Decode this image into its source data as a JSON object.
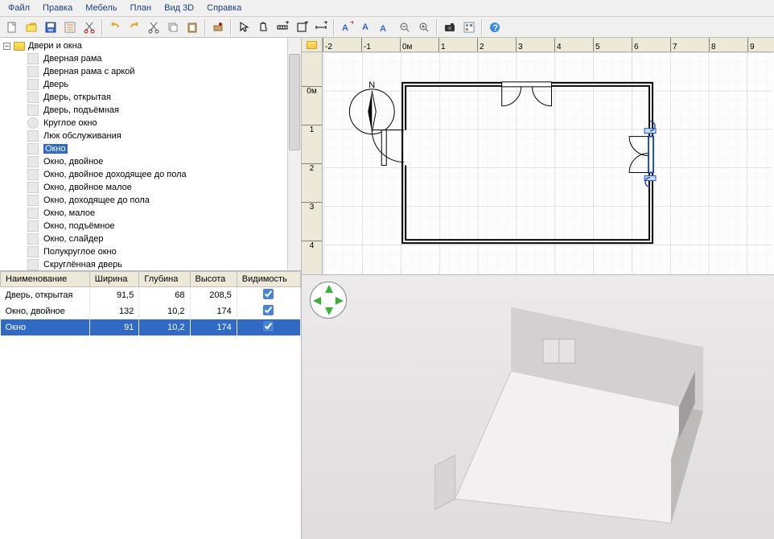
{
  "menu": {
    "items": [
      "Файл",
      "Правка",
      "Мебель",
      "План",
      "Вид 3D",
      "Справка"
    ]
  },
  "catalog": {
    "title": "Двери и окна",
    "items": [
      {
        "label": "Дверная рама"
      },
      {
        "label": "Дверная рама с аркой"
      },
      {
        "label": "Дверь"
      },
      {
        "label": "Дверь, открытая"
      },
      {
        "label": "Дверь, подъёмная"
      },
      {
        "label": "Круглое окно",
        "round": true
      },
      {
        "label": "Люк обслуживания"
      },
      {
        "label": "Окно",
        "selected": true
      },
      {
        "label": "Окно, двойное"
      },
      {
        "label": "Окно, двойное доходящее до пола"
      },
      {
        "label": "Окно, двойное малое"
      },
      {
        "label": "Окно, доходящее до пола"
      },
      {
        "label": "Окно, малое"
      },
      {
        "label": "Окно, подъёмное"
      },
      {
        "label": "Окно, слайдер"
      },
      {
        "label": "Полукруглое окно"
      },
      {
        "label": "Скруглённая дверь"
      }
    ]
  },
  "furniture_table": {
    "headers": {
      "name": "Наименование",
      "width": "Ширина",
      "depth": "Глубина",
      "height": "Высота",
      "visible": "Видимость"
    },
    "rows": [
      {
        "name": "Дверь, открытая",
        "width": "91,5",
        "depth": "68",
        "height": "208,5",
        "visible": true
      },
      {
        "name": "Окно, двойное",
        "width": "132",
        "depth": "10,2",
        "height": "174",
        "visible": true
      },
      {
        "name": "Окно",
        "width": "91",
        "depth": "10,2",
        "height": "174",
        "visible": true,
        "selected": true
      }
    ]
  },
  "ruler": {
    "h_labels": [
      "-2",
      "-1",
      "0м",
      "1",
      "2",
      "3",
      "4",
      "5",
      "6",
      "7",
      "8",
      "9"
    ],
    "v_labels": [
      "0м",
      "1",
      "2",
      "3",
      "4"
    ]
  },
  "compass_label": "N"
}
